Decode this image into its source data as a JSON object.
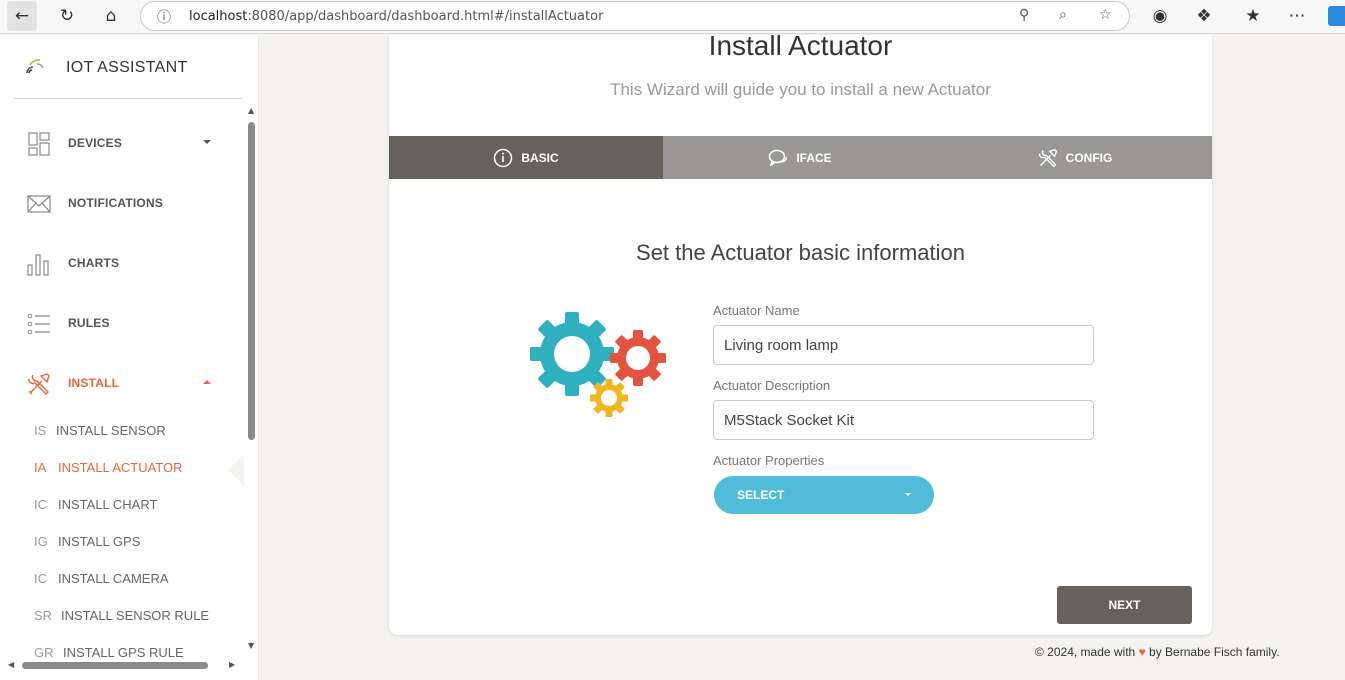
{
  "browser": {
    "url_host": "localhost",
    "url_rest": ":8080/app/dashboard/dashboard.html#/installActuator"
  },
  "sidebar": {
    "logo_text": "IOT ASSISTANT",
    "items": [
      {
        "label": "DEVICES",
        "icon": "devices-icon"
      },
      {
        "label": "NOTIFICATIONS",
        "icon": "envelope-icon"
      },
      {
        "label": "CHARTS",
        "icon": "bar-chart-icon"
      },
      {
        "label": "RULES",
        "icon": "list-icon"
      },
      {
        "label": "INSTALL",
        "icon": "tools-icon"
      }
    ],
    "install_sub": [
      {
        "abbr": "IS",
        "label": "INSTALL SENSOR"
      },
      {
        "abbr": "IA",
        "label": "INSTALL ACTUATOR"
      },
      {
        "abbr": "IC",
        "label": "INSTALL CHART"
      },
      {
        "abbr": "IG",
        "label": "INSTALL GPS"
      },
      {
        "abbr": "IC",
        "label": "INSTALL CAMERA"
      },
      {
        "abbr": "SR",
        "label": "INSTALL SENSOR RULE"
      },
      {
        "abbr": "GR",
        "label": "INSTALL GPS RULE"
      }
    ]
  },
  "wizard": {
    "title": "Install Actuator",
    "subtitle": "This Wizard will guide you to install a new Actuator",
    "tabs": [
      {
        "label": "BASIC",
        "icon": "info-icon"
      },
      {
        "label": "IFACE",
        "icon": "chat-icon"
      },
      {
        "label": "CONFIG",
        "icon": "tools-icon"
      }
    ],
    "step_title": "Set the Actuator basic information",
    "fields": {
      "name_label": "Actuator Name",
      "name_value": "Living room lamp",
      "desc_label": "Actuator Description",
      "desc_value": "M5Stack Socket Kit",
      "props_label": "Actuator Properties",
      "select_label": "SELECT"
    },
    "next_label": "NEXT"
  },
  "footer": {
    "prefix": "© 2024, made with",
    "suffix": "by Bernabe Fisch family."
  },
  "colors": {
    "accent": "#e8673c",
    "tab_active": "#66615b",
    "select": "#51bcda",
    "gear_teal": "#2fb0bf",
    "gear_red": "#e25440",
    "gear_yellow": "#f0b81e"
  }
}
